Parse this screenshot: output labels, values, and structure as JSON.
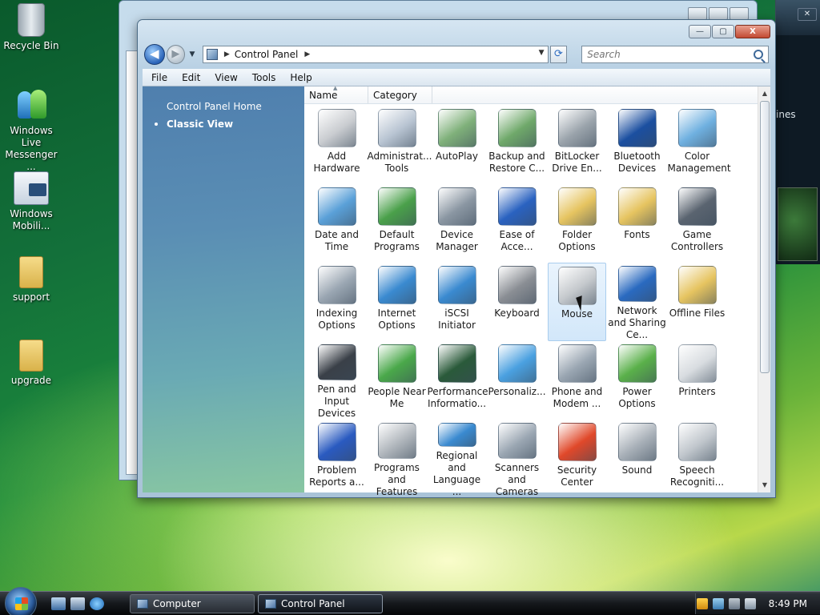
{
  "desktop": {
    "icons": [
      {
        "label": "Recycle Bin"
      },
      {
        "label": "Windows Live Messenger ..."
      },
      {
        "label": "Windows Mobili..."
      },
      {
        "label": "support"
      },
      {
        "label": "upgrade"
      }
    ]
  },
  "side_window": {
    "text_fragment": "ines"
  },
  "window": {
    "caption_buttons": {
      "minimize": "—",
      "maximize": "▢",
      "close": "X"
    },
    "nav": {
      "back": "◀",
      "forward": "▶",
      "recent": "▼"
    },
    "address": {
      "crumb": "Control Panel"
    },
    "search": {
      "placeholder": "Search"
    },
    "menu": [
      "File",
      "Edit",
      "View",
      "Tools",
      "Help"
    ],
    "sidebar": {
      "home_link": "Control Panel Home",
      "current_view": "Classic View"
    },
    "columns": {
      "name": "Name",
      "category": "Category"
    },
    "items": [
      {
        "label": "Add Hardware",
        "icon": "add-hardware-icon",
        "color": "#c9ccd0"
      },
      {
        "label": "Administrat... Tools",
        "icon": "administrative-tools-icon",
        "color": "#b8c4d2"
      },
      {
        "label": "AutoPlay",
        "icon": "autoplay-icon",
        "color": "#7fb07a"
      },
      {
        "label": "Backup and Restore C...",
        "icon": "backup-restore-icon",
        "color": "#6fa86a"
      },
      {
        "label": "BitLocker Drive En...",
        "icon": "bitlocker-icon",
        "color": "#9aa3ab"
      },
      {
        "label": "Bluetooth Devices",
        "icon": "bluetooth-icon",
        "color": "#1b4fa0"
      },
      {
        "label": "Color Management",
        "icon": "color-management-icon",
        "color": "#6fb0e0"
      },
      {
        "label": "Date and Time",
        "icon": "date-time-icon",
        "color": "#5aa0d8"
      },
      {
        "label": "Default Programs",
        "icon": "default-programs-icon",
        "color": "#4aa04a"
      },
      {
        "label": "Device Manager",
        "icon": "device-manager-icon",
        "color": "#8a96a2"
      },
      {
        "label": "Ease of Acce...",
        "icon": "ease-of-access-icon",
        "color": "#2a62c0"
      },
      {
        "label": "Folder Options",
        "icon": "folder-options-icon",
        "color": "#e6c460"
      },
      {
        "label": "Fonts",
        "icon": "fonts-icon",
        "color": "#e6c460"
      },
      {
        "label": "Game Controllers",
        "icon": "game-controllers-icon",
        "color": "#5a6470"
      },
      {
        "label": "Indexing Options",
        "icon": "indexing-options-icon",
        "color": "#9aa6b2"
      },
      {
        "label": "Internet Options",
        "icon": "internet-options-icon",
        "color": "#3a8ad0"
      },
      {
        "label": "iSCSI Initiator",
        "icon": "iscsi-initiator-icon",
        "color": "#3a8ad0"
      },
      {
        "label": "Keyboard",
        "icon": "keyboard-icon",
        "color": "#8a8e94"
      },
      {
        "label": "Mouse",
        "icon": "mouse-icon",
        "color": "#c4c8cc"
      },
      {
        "label": "Network and Sharing Ce...",
        "icon": "network-sharing-icon",
        "color": "#2a6ac0"
      },
      {
        "label": "Offline Files",
        "icon": "offline-files-icon",
        "color": "#e6c460"
      },
      {
        "label": "Pen and Input Devices",
        "icon": "pen-input-icon",
        "color": "#3a4048"
      },
      {
        "label": "People Near Me",
        "icon": "people-near-me-icon",
        "color": "#4aa84a"
      },
      {
        "label": "Performance Informatio...",
        "icon": "performance-icon",
        "color": "#2a5a3a"
      },
      {
        "label": "Personaliz...",
        "icon": "personalization-icon",
        "color": "#4aa0e0"
      },
      {
        "label": "Phone and Modem ...",
        "icon": "phone-modem-icon",
        "color": "#9aa6b2"
      },
      {
        "label": "Power Options",
        "icon": "power-options-icon",
        "color": "#5ab04a"
      },
      {
        "label": "Printers",
        "icon": "printers-icon",
        "color": "#d8dce0"
      },
      {
        "label": "Problem Reports a...",
        "icon": "problem-reports-icon",
        "color": "#2a5ac0"
      },
      {
        "label": "Programs and Features",
        "icon": "programs-features-icon",
        "color": "#b0b6bc"
      },
      {
        "label": "Regional and Language ...",
        "icon": "regional-language-icon",
        "color": "#3a8ad0"
      },
      {
        "label": "Scanners and Cameras",
        "icon": "scanners-cameras-icon",
        "color": "#9aa6b2"
      },
      {
        "label": "Security Center",
        "icon": "security-center-icon",
        "color": "#e0482a"
      },
      {
        "label": "Sound",
        "icon": "sound-icon",
        "color": "#a8b0b8"
      },
      {
        "label": "Speech Recogniti...",
        "icon": "speech-recognition-icon",
        "color": "#c0c6cc"
      }
    ],
    "selected_item": "Mouse"
  },
  "taskbar": {
    "buttons": [
      {
        "label": "Computer"
      },
      {
        "label": "Control Panel"
      }
    ],
    "clock": "8:49 PM"
  }
}
